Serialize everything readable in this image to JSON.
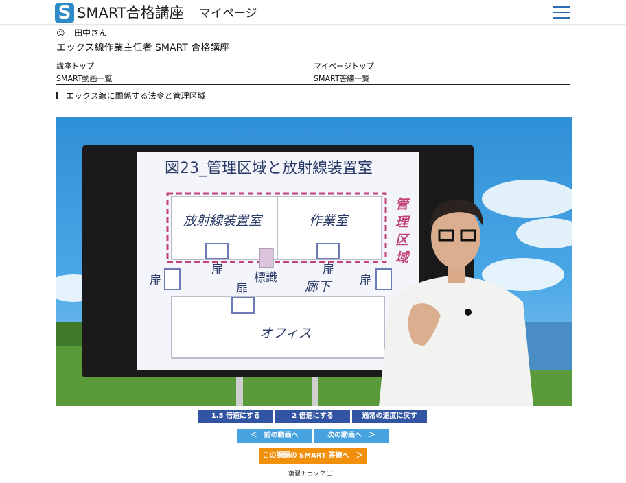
{
  "header": {
    "logo_letter": "S",
    "brand": "SMART合格講座",
    "page_name": "マイページ",
    "menu_icon": "hamburger-menu-icon"
  },
  "user": {
    "icon": "smiley-face-icon",
    "name": "田中さん"
  },
  "course_title": "エックス線作業主任者 SMART 合格講座",
  "nav": {
    "course_top": "講座トップ",
    "mypage_top": "マイページトップ",
    "video_list": "SMART動画一覧",
    "answer_list": "SMART答練一覧"
  },
  "section_title": "エックス線に関係する法令と管理区域",
  "slide": {
    "title": "図23_管理区域と放射線装置室",
    "room_xray": "放射線装置室",
    "room_work": "作業室",
    "area_label": "管理区域",
    "door": "扉",
    "sign": "標識",
    "corridor": "廊下",
    "office": "オフィス"
  },
  "controls": {
    "speed_15": "1.5 倍速にする",
    "speed_2": "2 倍速にする",
    "speed_normal": "通常の速度に戻す",
    "prev_video": "＜　前の動画へ",
    "next_video": "次の動画へ　＞",
    "smart_answer": "この課題の SMART 答練へ　＞",
    "review_check": "復習チェック"
  },
  "colors": {
    "brand_blue": "#2d8bc8",
    "button_dark_blue": "#3155a2",
    "button_light_blue": "#46a3e0",
    "button_orange": "#f0900c",
    "area_border": "#c2447a"
  }
}
